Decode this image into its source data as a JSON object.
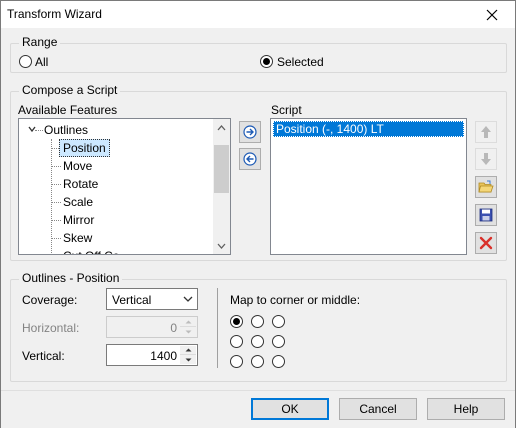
{
  "window": {
    "title": "Transform Wizard"
  },
  "range": {
    "label": "Range",
    "options": [
      {
        "label": "All",
        "checked": false
      },
      {
        "label": "Selected",
        "checked": true
      }
    ]
  },
  "compose": {
    "label": "Compose a Script",
    "available_label": "Available Features",
    "script_label": "Script",
    "tree": {
      "root": "Outlines",
      "children": [
        "Position",
        "Move",
        "Rotate",
        "Scale",
        "Mirror",
        "Skew",
        "Cut Off Co..."
      ],
      "selected": "Position"
    },
    "script_items": [
      "Position (-, 1400) LT"
    ]
  },
  "params": {
    "label": "Outlines - Position",
    "coverage_label": "Coverage:",
    "coverage_value": "Vertical",
    "horizontal_label": "Horizontal:",
    "horizontal_value": "0",
    "vertical_label": "Vertical:",
    "vertical_value": "1400",
    "map_label": "Map to corner or middle:",
    "map_selected": "top-left"
  },
  "buttons": {
    "ok": "OK",
    "cancel": "Cancel",
    "help": "Help"
  },
  "icons": {
    "add": "arrow-right-circle-icon",
    "remove": "arrow-left-circle-icon",
    "up": "arrow-up-icon",
    "down": "arrow-down-icon",
    "open": "folder-open-icon",
    "save": "floppy-disk-icon",
    "delete": "red-x-icon"
  }
}
